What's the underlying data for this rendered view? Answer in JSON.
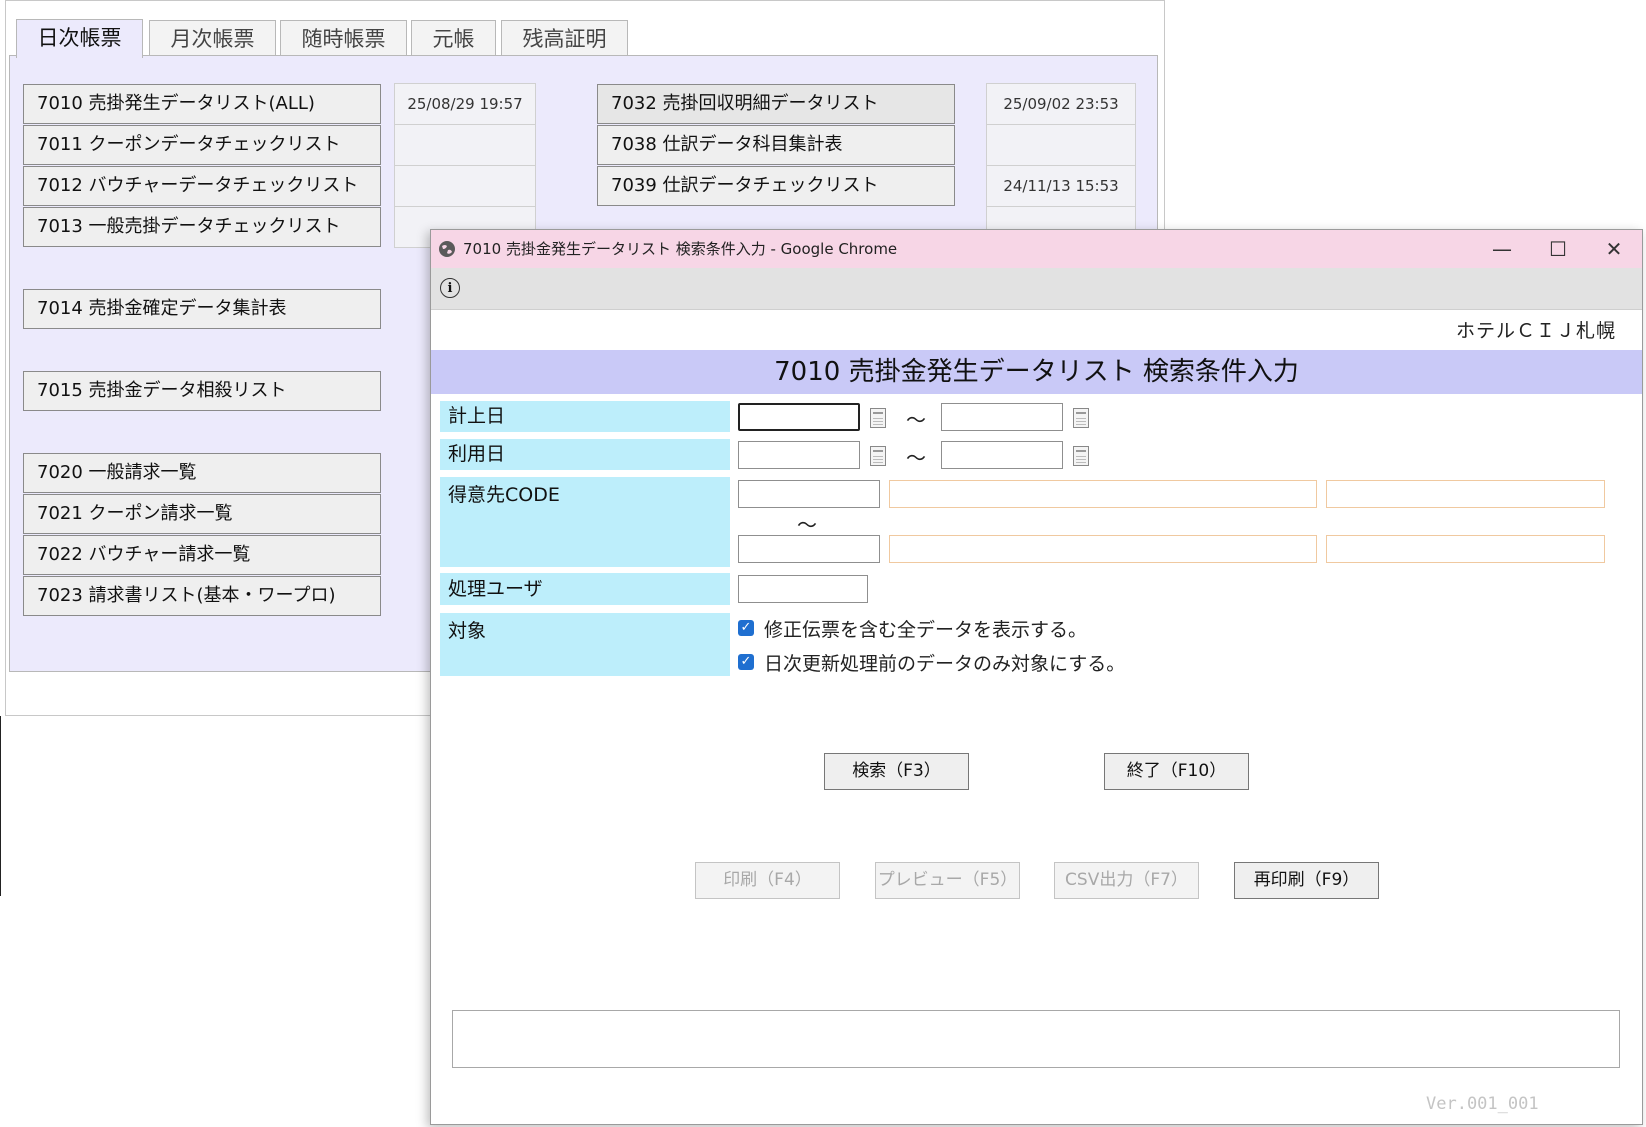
{
  "background_window": {
    "tabs": [
      "日次帳票",
      "月次帳票",
      "随時帳票",
      "元帳",
      "残高証明"
    ],
    "active_tab": "日次帳票",
    "left_reports": [
      "7010 売掛発生データリスト(ALL)",
      "7011 クーポンデータチェックリスト",
      "7012 バウチャーデータチェックリスト",
      "7013 一般売掛データチェックリスト",
      "7014 売掛金確定データ集計表",
      "7015 売掛金データ相殺リスト",
      "7020 一般請求一覧",
      "7021 クーポン請求一覧",
      "7022 バウチャー請求一覧",
      "7023 請求書リスト(基本・ワープロ)"
    ],
    "left_timestamps": [
      "25/08/29 19:57"
    ],
    "right_reports": [
      "7032 売掛回収明細データリスト",
      "7038 仕訳データ科目集計表",
      "7039 仕訳データチェックリスト"
    ],
    "right_timestamps": [
      "25/09/02 23:53",
      "",
      "24/11/13 15:53"
    ]
  },
  "popup": {
    "title": "7010 売掛金発生データリスト 検索条件入力 - Google Chrome",
    "controls": {
      "minimize": "—",
      "maximize": "☐",
      "close": "✕"
    },
    "info_icon": "i",
    "hotel_name": "ホテルＣＩＪ札幌",
    "heading": "7010 売掛金発生データリスト 検索条件入力",
    "fields": {
      "keijo_label": "計上日",
      "riyo_label": "利用日",
      "tokuisaki_label": "得意先CODE",
      "user_label": "処理ユーザ",
      "taisho_label": "対象",
      "range_sep": "～"
    },
    "checkboxes": [
      {
        "label": "修正伝票を含む全データを表示する。",
        "checked": true
      },
      {
        "label": "日次更新処理前のデータのみ対象にする。",
        "checked": true
      }
    ],
    "buttons": {
      "search": "検索（F3）",
      "exit": "終了（F10）",
      "print": "印刷（F4）",
      "preview": "プレビュー（F5）",
      "csv": "CSV出力（F7）",
      "reprint": "再印刷（F9）"
    },
    "version": "Ver.001_001"
  }
}
